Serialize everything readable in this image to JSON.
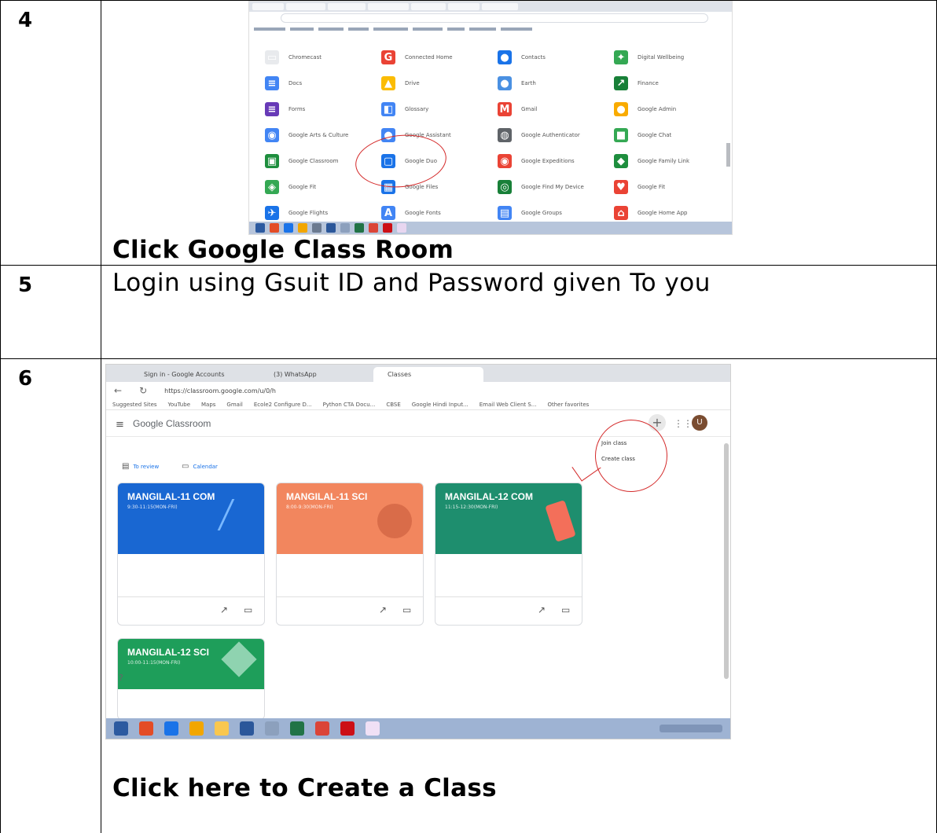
{
  "steps": [
    {
      "number": "4",
      "caption": "Click Google Class Room"
    },
    {
      "number": "5",
      "caption": "Login using Gsuit ID and Password given To you"
    },
    {
      "number": "6",
      "caption": "Click here to Create a Class"
    }
  ],
  "shot1": {
    "apps": [
      {
        "label": "Chromecast",
        "icon": "chromecast-icon",
        "color": "#e8eaed",
        "glyph": "▭"
      },
      {
        "label": "Connected Home",
        "icon": "google-g-icon",
        "color": "#ea4335",
        "glyph": "G"
      },
      {
        "label": "Contacts",
        "icon": "contacts-icon",
        "color": "#1a73e8",
        "glyph": "●"
      },
      {
        "label": "Digital Wellbeing",
        "icon": "wellbeing-icon",
        "color": "#34a853",
        "glyph": "✦"
      },
      {
        "label": "Docs",
        "icon": "docs-icon",
        "color": "#4285f4",
        "glyph": "≡"
      },
      {
        "label": "Drive",
        "icon": "drive-icon",
        "color": "#fbbc04",
        "glyph": "▲"
      },
      {
        "label": "Earth",
        "icon": "earth-icon",
        "color": "#4a90e2",
        "glyph": "●"
      },
      {
        "label": "Finance",
        "icon": "finance-icon",
        "color": "#188038",
        "glyph": "↗"
      },
      {
        "label": "Forms",
        "icon": "forms-icon",
        "color": "#673ab7",
        "glyph": "≡"
      },
      {
        "label": "Glossary",
        "icon": "glossary-icon",
        "color": "#4285f4",
        "glyph": "◧"
      },
      {
        "label": "Gmail",
        "icon": "gmail-icon",
        "color": "#ea4335",
        "glyph": "M"
      },
      {
        "label": "Google Admin",
        "icon": "admin-icon",
        "color": "#f9ab00",
        "glyph": "●"
      },
      {
        "label": "Google Arts & Culture",
        "icon": "arts-icon",
        "color": "#4285f4",
        "glyph": "◉"
      },
      {
        "label": "Google Assistant",
        "icon": "assistant-icon",
        "color": "#4285f4",
        "glyph": "●"
      },
      {
        "label": "Google Authenticator",
        "icon": "authenticator-icon",
        "color": "#5f6368",
        "glyph": "◍"
      },
      {
        "label": "Google Chat",
        "icon": "chat-icon",
        "color": "#34a853",
        "glyph": "■"
      },
      {
        "label": "Google Classroom",
        "icon": "classroom-icon",
        "color": "#1e8e3e",
        "glyph": "▣"
      },
      {
        "label": "Google Duo",
        "icon": "duo-icon",
        "color": "#1a73e8",
        "glyph": "▢"
      },
      {
        "label": "Google Expeditions",
        "icon": "expeditions-icon",
        "color": "#ea4335",
        "glyph": "◉"
      },
      {
        "label": "Google Family Link",
        "icon": "family-link-icon",
        "color": "#1e8e3e",
        "glyph": "◆"
      },
      {
        "label": "Google Fit",
        "icon": "fit-icon",
        "color": "#34a853",
        "glyph": "◈"
      },
      {
        "label": "Google Files",
        "icon": "files-icon",
        "color": "#1a73e8",
        "glyph": "▦"
      },
      {
        "label": "Google Find My Device",
        "icon": "find-device-icon",
        "color": "#188038",
        "glyph": "◎"
      },
      {
        "label": "Google Fit",
        "icon": "fit-heart-icon",
        "color": "#ea4335",
        "glyph": "♥"
      },
      {
        "label": "Google Flights",
        "icon": "flights-icon",
        "color": "#1a73e8",
        "glyph": "✈"
      },
      {
        "label": "Google Fonts",
        "icon": "fonts-icon",
        "color": "#4285f4",
        "glyph": "A"
      },
      {
        "label": "Google Groups",
        "icon": "groups-icon",
        "color": "#4285f4",
        "glyph": "▤"
      },
      {
        "label": "Google Home App",
        "icon": "home-icon",
        "color": "#ea4335",
        "glyph": "⌂"
      }
    ]
  },
  "shot2": {
    "tabs": [
      "Sign in - Google Accounts",
      "(3) WhatsApp",
      "Classes"
    ],
    "url": "https://classroom.google.com/u/0/h",
    "bookmarks": [
      "Suggested Sites",
      "YouTube",
      "Maps",
      "Gmail",
      "Ecole2 Configure D...",
      "Python CTA Docu...",
      "CBSE",
      "Google Hindi Input...",
      "Email Web Client S...",
      "Other favorites"
    ],
    "brand": "Google Classroom",
    "avatar_letter": "U",
    "menu": [
      "Join class",
      "Create class"
    ],
    "subnav": [
      "To review",
      "Calendar"
    ],
    "cards": [
      {
        "name": "MANGILAL-11 COM",
        "section": "9:30-11:15(MON-FRI)",
        "color": "#1967d2"
      },
      {
        "name": "MANGILAL-11 SCI",
        "section": "8:00-9:30(MON-FRI)",
        "color": "#f2865e"
      },
      {
        "name": "MANGILAL-12 COM",
        "section": "11:15-12:30(MON-FRI)",
        "color": "#1e8e6e"
      },
      {
        "name": "MANGILAL-12 SCI",
        "section": "10:00-11:15(MON-FRI)",
        "color": "#1e9e5a"
      }
    ]
  }
}
